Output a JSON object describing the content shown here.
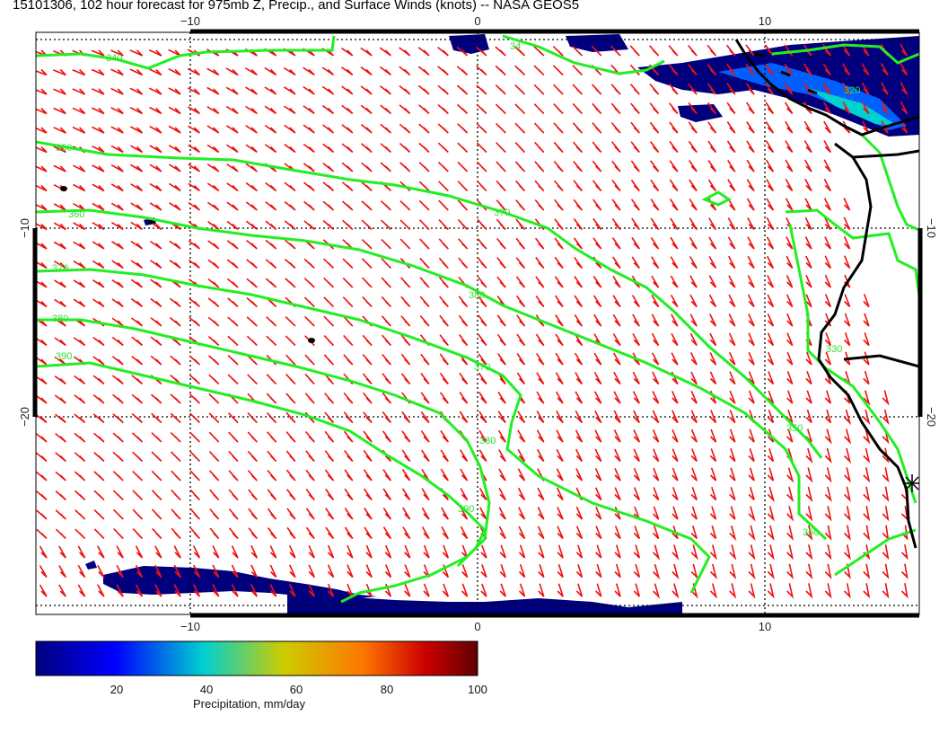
{
  "title": "15101306, 102 hour forecast for 975mb Z, Precip., and Surface Winds (knots) -- NASA GEOS5",
  "axes": {
    "x_ticks_top": [
      "−10",
      "0",
      "10"
    ],
    "x_ticks_bottom": [
      "−10",
      "0",
      "10"
    ],
    "y_ticks_left": [
      "−10",
      "−20"
    ],
    "y_ticks_right": [
      "−10",
      "−20"
    ],
    "lon_range": [
      -15,
      15.5
    ],
    "lat_range": [
      -30,
      0.3
    ]
  },
  "contours": {
    "color": "#22ee22",
    "levels": [
      "340",
      "350",
      "360",
      "370",
      "380",
      "390"
    ],
    "labels": [
      "340",
      "34",
      "350",
      "360",
      "370",
      "380",
      "390",
      "370",
      "380",
      "370",
      "380",
      "390",
      "350",
      "360",
      "330",
      "320"
    ]
  },
  "wind_barbs": {
    "color": "#ee1111",
    "units": "knots"
  },
  "precipitation": {
    "colorbar_ticks": [
      "20",
      "40",
      "60",
      "80",
      "100"
    ],
    "colorbar_label": "Precipitation, mm/day",
    "range": [
      0,
      100
    ],
    "colors": [
      "#00007f",
      "#0000ff",
      "#00d0d0",
      "#cccc00",
      "#ff7700",
      "#cc0000",
      "#600000"
    ]
  },
  "coastline_color": "#000000"
}
